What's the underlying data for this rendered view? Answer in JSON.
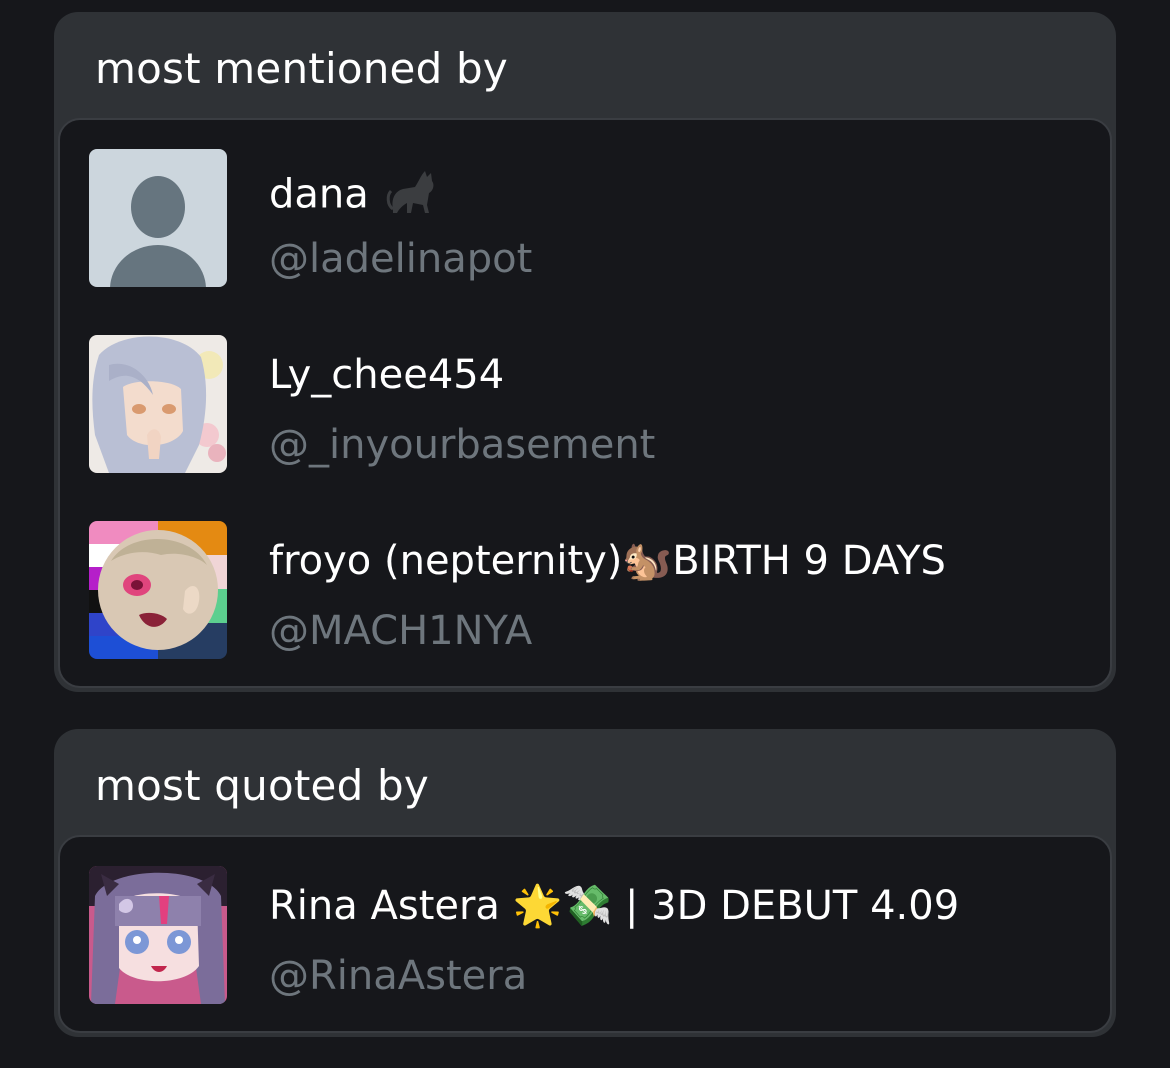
{
  "sections": [
    {
      "title": "most mentioned by",
      "users": [
        {
          "name": "dana",
          "handle": "@ladelinapot",
          "avatar": "default-avatar",
          "emoji": "black-cat-icon"
        },
        {
          "name": "Ly_chee454",
          "handle": "@_inyourbasement",
          "avatar": "anime-avatar-silver-hair"
        },
        {
          "name": "froyo (nepternity)🐿️BIRTH 9 DAYS",
          "handle": "@MACH1NYA",
          "avatar": "anime-avatar-pride-flag"
        }
      ]
    },
    {
      "title": "most quoted by",
      "users": [
        {
          "name": "Rina Astera 🌟💸 | 3D DEBUT 4.09",
          "handle": "@RinaAstera",
          "avatar": "anime-avatar-purple-hair"
        }
      ]
    }
  ],
  "colors": {
    "background": "#16171b",
    "card": "#2f3236",
    "name": "#ffffff",
    "handle": "#6e767d"
  }
}
